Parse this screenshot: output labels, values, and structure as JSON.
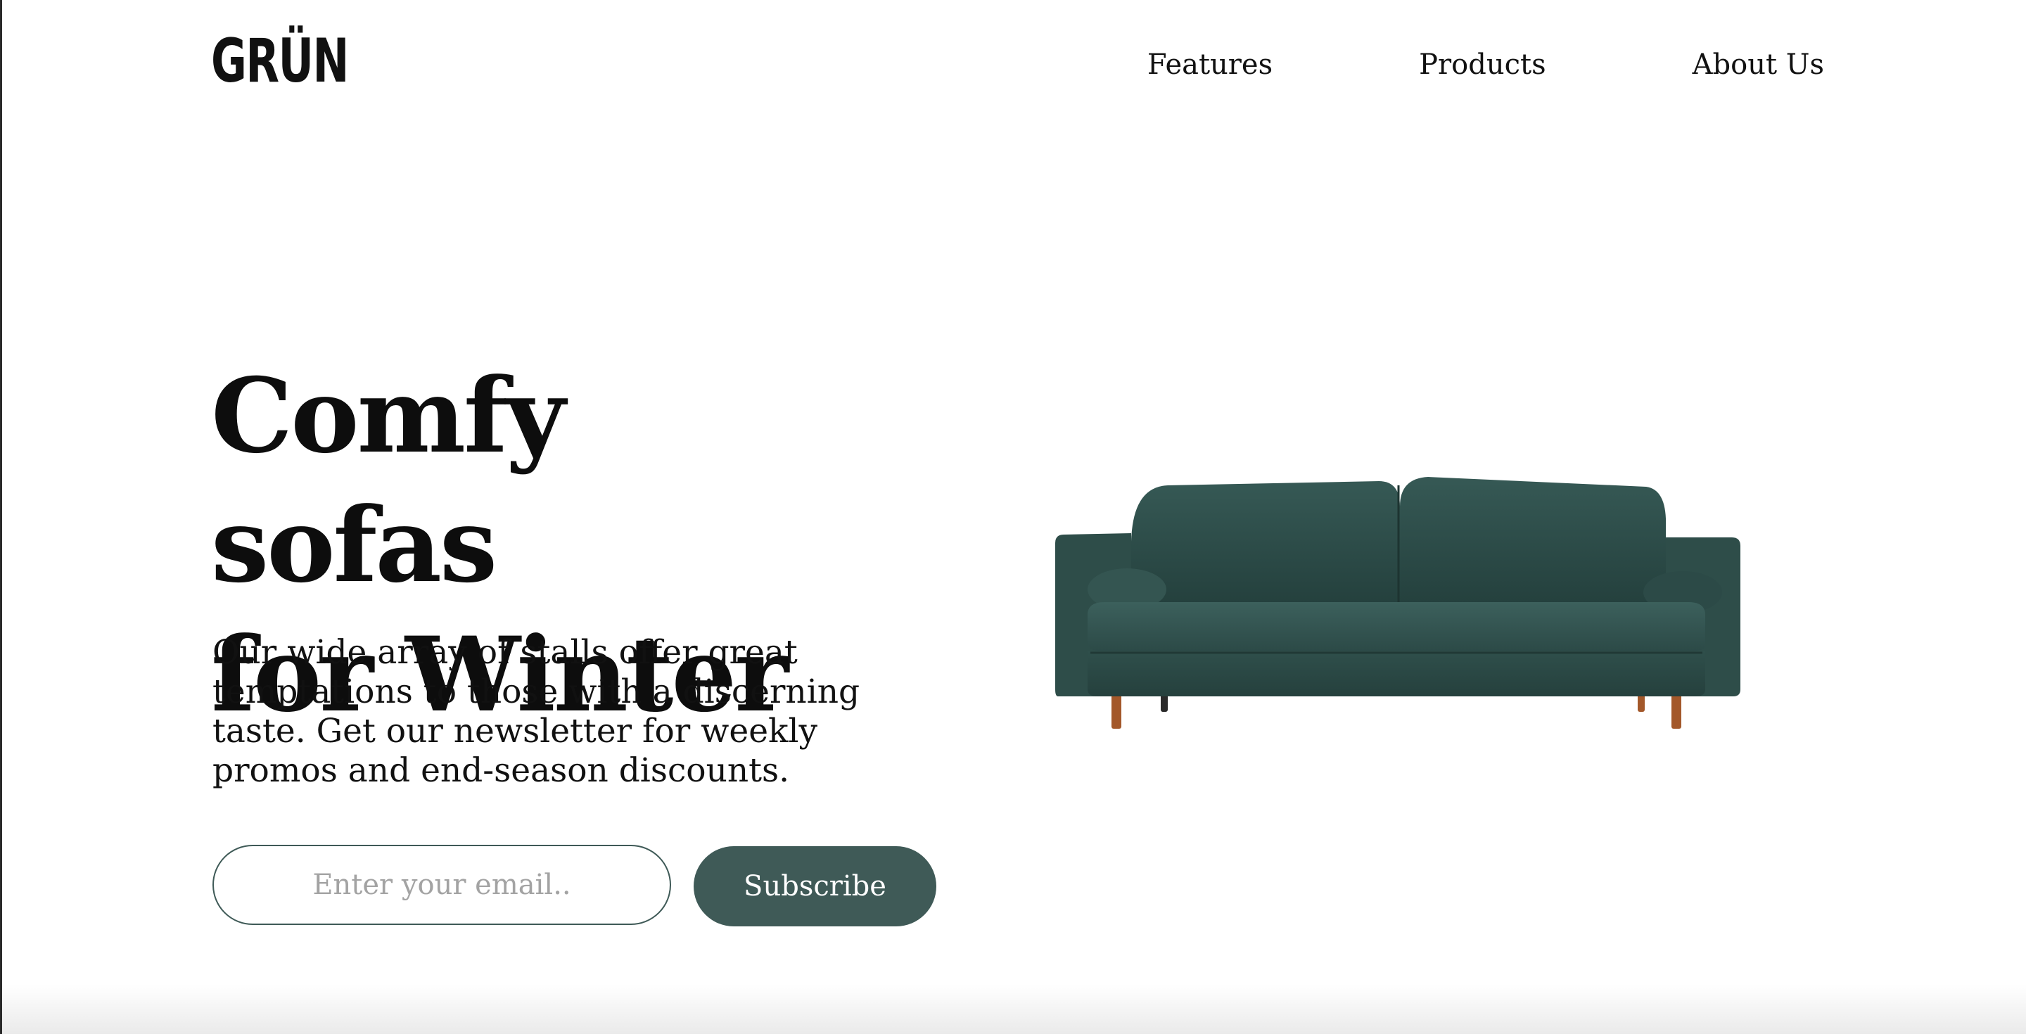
{
  "brand": {
    "logo_text": "GRÜN"
  },
  "nav": {
    "items": [
      {
        "label": "Features"
      },
      {
        "label": "Products"
      },
      {
        "label": "About Us"
      }
    ]
  },
  "hero": {
    "headline_line1": "Comfy sofas",
    "headline_line2": "for Winter",
    "description": "Our wide array of stalls offer great temptations to those with a discerning taste. Get our newsletter for weekly promos and end-season discounts.",
    "email_placeholder": "Enter your email..",
    "subscribe_label": "Subscribe",
    "image": "green-velvet-sofa"
  },
  "colors": {
    "accent": "#3f5a57",
    "sofa": "#2f4f4b",
    "legs": "#a3582a",
    "text": "#111111",
    "background": "#ffffff"
  }
}
